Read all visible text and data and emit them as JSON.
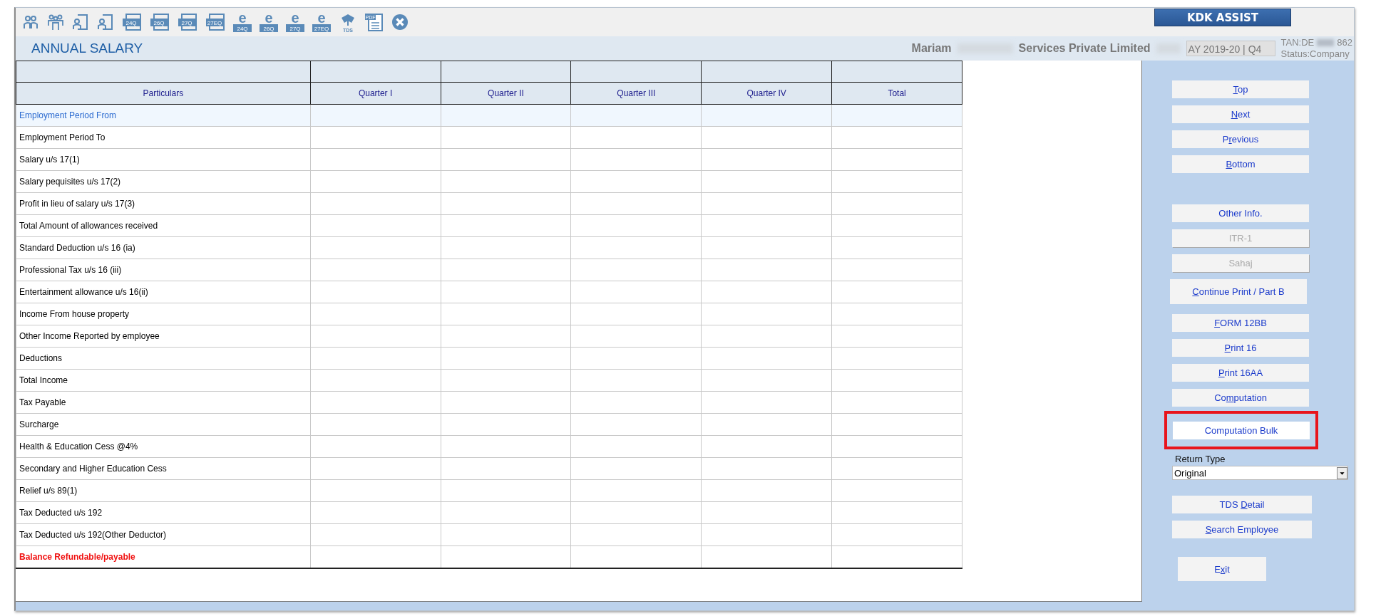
{
  "toolbar": [
    {
      "kind": "person"
    },
    {
      "kind": "group"
    },
    {
      "kind": "user-form"
    },
    {
      "kind": "user-form"
    },
    {
      "kind": "form",
      "text": "24Q"
    },
    {
      "kind": "form",
      "text": "26Q"
    },
    {
      "kind": "form",
      "text": "27Q"
    },
    {
      "kind": "form",
      "text": "27EQ"
    },
    {
      "kind": "e-file",
      "letter": "e",
      "text": "24Q"
    },
    {
      "kind": "e-file",
      "letter": "e",
      "text": "26Q"
    },
    {
      "kind": "e-file",
      "letter": "e",
      "text": "27Q"
    },
    {
      "kind": "e-file",
      "letter": "e",
      "text": "27EQ"
    },
    {
      "kind": "tds",
      "text": "TDS"
    },
    {
      "kind": "pdf",
      "text": "PDF"
    },
    {
      "kind": "close"
    }
  ],
  "assist_button": "KDK ASSIST",
  "header": {
    "title": "ANNUAL SALARY",
    "company_parts": [
      "Mariam",
      "Services Private Limited"
    ],
    "period": "AY 2019-20 | Q4",
    "tan_parts": [
      "TAN:DE",
      "862"
    ],
    "status": "Status:Company"
  },
  "table": {
    "columns": [
      "Particulars",
      "Quarter I",
      "Quarter II",
      "Quarter III",
      "Quarter IV",
      "Total"
    ],
    "rows": [
      {
        "label": "Employment Period From",
        "selected": true,
        "kind": "normal"
      },
      {
        "label": "Employment Period To",
        "selected": false,
        "kind": "normal"
      },
      {
        "label": "Salary u/s 17(1)",
        "selected": false,
        "kind": "normal"
      },
      {
        "label": "Salary pequisites u/s 17(2)",
        "selected": false,
        "kind": "normal"
      },
      {
        "label": "Profit in lieu of salary u/s 17(3)",
        "selected": false,
        "kind": "normal"
      },
      {
        "label": "Total Amount of allowances received",
        "selected": false,
        "kind": "normal"
      },
      {
        "label": "Standard Deduction u/s 16 (ia)",
        "selected": false,
        "kind": "normal"
      },
      {
        "label": "Professional Tax u/s 16 (iii)",
        "selected": false,
        "kind": "normal"
      },
      {
        "label": "Entertainment allowance u/s 16(ii)",
        "selected": false,
        "kind": "normal"
      },
      {
        "label": "Income From house property",
        "selected": false,
        "kind": "normal"
      },
      {
        "label": "Other Income Reported by employee",
        "selected": false,
        "kind": "normal"
      },
      {
        "label": "Deductions",
        "selected": false,
        "kind": "normal"
      },
      {
        "label": "Total Income",
        "selected": false,
        "kind": "normal"
      },
      {
        "label": "Tax Payable",
        "selected": false,
        "kind": "normal"
      },
      {
        "label": "Surcharge",
        "selected": false,
        "kind": "normal"
      },
      {
        "label": "Health & Education Cess @4%",
        "selected": false,
        "kind": "normal"
      },
      {
        "label": "Secondary and Higher Education Cess",
        "selected": false,
        "kind": "normal"
      },
      {
        "label": "Relief u/s 89(1)",
        "selected": false,
        "kind": "normal"
      },
      {
        "label": "Tax Deducted u/s 192",
        "selected": false,
        "kind": "normal"
      },
      {
        "label": "Tax Deducted u/s 192(Other Deductor)",
        "selected": false,
        "kind": "normal"
      },
      {
        "label": "Balance Refundable/payable",
        "selected": false,
        "kind": "result"
      }
    ]
  },
  "side_panel": {
    "groups": [
      [
        {
          "label": {
            "key": "T",
            "after": "op"
          },
          "kind": "normal",
          "disabled": false,
          "highlighted": false
        },
        {
          "label": {
            "key": "N",
            "after": "ext"
          },
          "kind": "normal",
          "disabled": false,
          "highlighted": false
        },
        {
          "label": {
            "before": "P",
            "key": "r",
            "after": "evious"
          },
          "kind": "normal",
          "disabled": false,
          "highlighted": false
        },
        {
          "label": {
            "key": "B",
            "after": "ottom"
          },
          "kind": "normal",
          "disabled": false,
          "highlighted": false
        }
      ],
      [
        {
          "label": {
            "before": "Other Info."
          },
          "kind": "normal",
          "disabled": false,
          "highlighted": false
        },
        {
          "label": {
            "before": "ITR-1"
          },
          "kind": "normal",
          "disabled": true,
          "highlighted": false
        },
        {
          "label": {
            "before": "Sahaj"
          },
          "kind": "normal",
          "disabled": true,
          "highlighted": false
        },
        {
          "label": {
            "key": "C",
            "after": "ontinue Print / Part B"
          },
          "kind": "tall",
          "disabled": false,
          "highlighted": false
        },
        {
          "label": {
            "key": "F",
            "after": "ORM 12BB"
          },
          "kind": "normal",
          "disabled": false,
          "highlighted": false
        },
        {
          "label": {
            "key": "P",
            "after": "rint 16"
          },
          "kind": "normal",
          "disabled": false,
          "highlighted": false
        },
        {
          "label": {
            "key": "P",
            "after": "rint 16AA"
          },
          "kind": "normal",
          "disabled": false,
          "highlighted": false
        },
        {
          "label": {
            "before": "Co",
            "key": "m",
            "after": "putation"
          },
          "kind": "normal",
          "disabled": false,
          "highlighted": false
        },
        {
          "label": {
            "before": "Computation Bulk"
          },
          "kind": "normal",
          "disabled": false,
          "highlighted": true
        }
      ]
    ],
    "return_type": {
      "label": "Return Type",
      "value": "Original"
    },
    "lower_groups": [
      [
        {
          "label": {
            "before": "TDS ",
            "key": "D",
            "after": "etail"
          },
          "kind": "normal",
          "disabled": false,
          "highlighted": false
        },
        {
          "label": {
            "key": "S",
            "after": "earch Employee"
          },
          "kind": "normal",
          "disabled": false,
          "highlighted": false
        }
      ],
      [
        {
          "label": {
            "before": "E",
            "key": "x",
            "after": "it"
          },
          "kind": "small",
          "disabled": false,
          "highlighted": false
        }
      ]
    ]
  }
}
